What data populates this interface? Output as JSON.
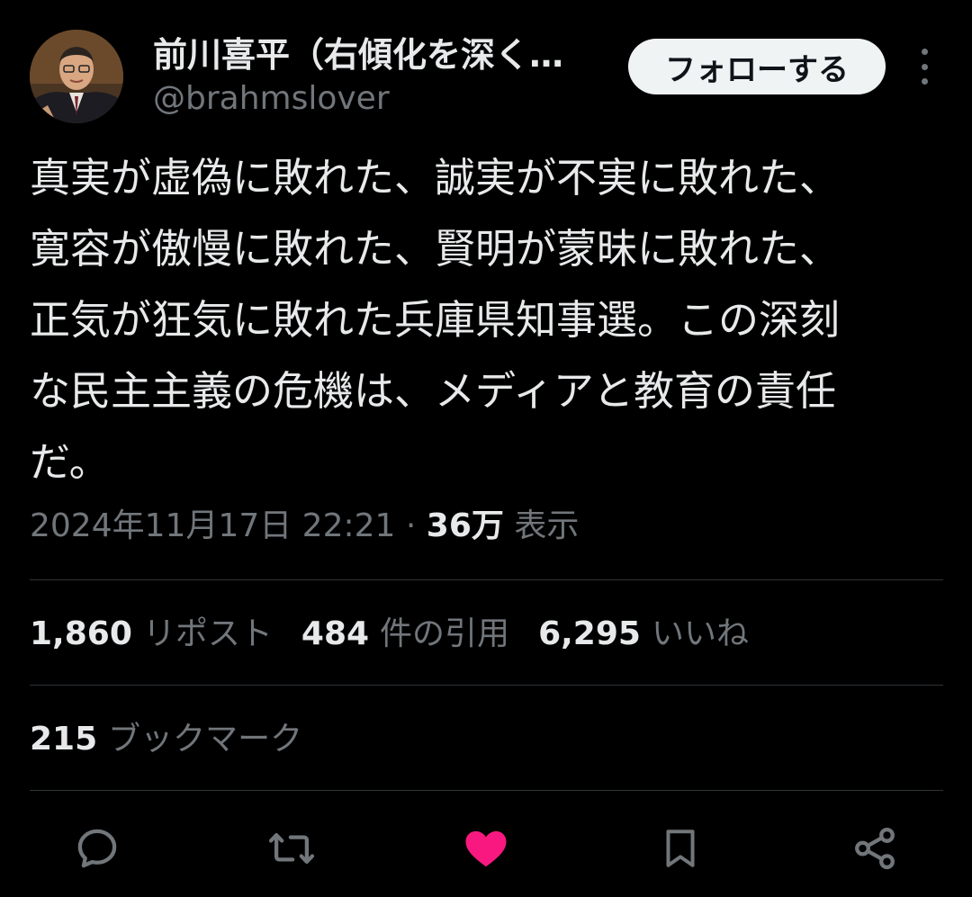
{
  "author": {
    "display_name": "前川喜平（右傾化を深く…",
    "handle": "@brahmslover",
    "follow_label": "フォローする"
  },
  "tweet": {
    "text": "真実が虚偽に敗れた、誠実が不実に敗れた、\n寛容が傲慢に敗れた、賢明が蒙昧に敗れた、\n正気が狂気に敗れた兵庫県知事選。この深刻\nな民主主義の危機は、メディアと教育の責任\nだ。",
    "timestamp": "2024年11月17日 22:21",
    "separator": "·",
    "views_count": "36万",
    "views_label": "表示"
  },
  "stats": {
    "reposts_count": "1,860",
    "reposts_label": "リポスト",
    "quotes_count": "484",
    "quotes_label": "件の引用",
    "likes_count": "6,295",
    "likes_label": "いいね",
    "bookmarks_count": "215",
    "bookmarks_label": "ブックマーク"
  },
  "actions": {
    "reply_icon": "reply-icon",
    "repost_icon": "repost-icon",
    "like_icon": "heart-icon",
    "bookmark_icon": "bookmark-icon",
    "share_icon": "share-icon"
  },
  "colors": {
    "background": "#000000",
    "text_primary": "#e7e9ea",
    "text_secondary": "#71767b",
    "divider": "#2f3336",
    "like_active": "#f91880",
    "follow_button_bg": "#eff3f4"
  }
}
